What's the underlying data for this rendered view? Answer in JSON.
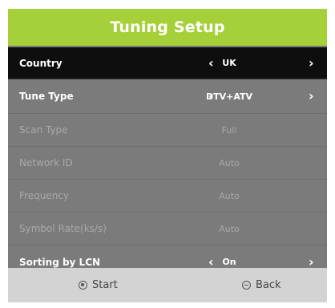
{
  "header": {
    "title": "Tuning Setup"
  },
  "arrows": {
    "left": "‹",
    "right": "›"
  },
  "rows": [
    {
      "label": "Country",
      "value": "UK",
      "state": "selected"
    },
    {
      "label": "Tune Type",
      "value": "DTV+ATV",
      "state": "active"
    },
    {
      "label": "Scan Type",
      "value": "Full",
      "state": "disabled"
    },
    {
      "label": "Network ID",
      "value": "Auto",
      "state": "disabled"
    },
    {
      "label": "Frequency",
      "value": "Auto",
      "state": "disabled"
    },
    {
      "label": "Symbol Rate(ks/s)",
      "value": "Auto",
      "state": "disabled"
    },
    {
      "label": "Sorting by LCN",
      "value": "On",
      "state": "active"
    }
  ],
  "footer": {
    "start_label": "Start",
    "back_label": "Back"
  },
  "colors": {
    "header": "#a6d03a",
    "selected_row": "#0e0e0e",
    "body": "#7b7b7b",
    "footer": "#d3d3d3"
  }
}
